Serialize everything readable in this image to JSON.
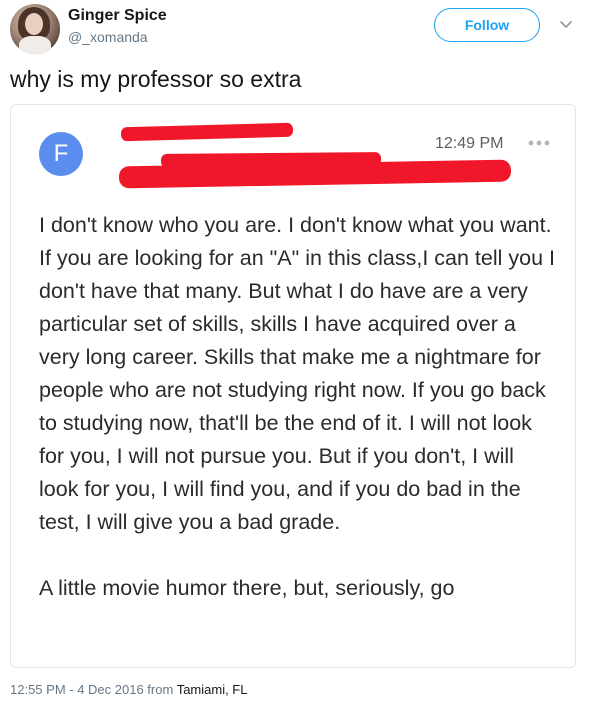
{
  "author": {
    "display_name": "Ginger Spice",
    "handle": "@_xomanda"
  },
  "actions": {
    "follow_label": "Follow",
    "menu_icon": "chevron-down-icon"
  },
  "tweet": {
    "text": "why is my professor so extra"
  },
  "email": {
    "sender_initial": "F",
    "time": "12:49 PM",
    "more_icon": "more-dots-icon",
    "paragraphs": [
      "I don't know who you are. I don't know what you want. If you are looking for an \"A\" in this class,I can tell you I don't have that many. But what I do have are a very particular set of skills, skills I have acquired over a very long career. Skills that make me a nightmare for people who are not studying right now. If you go back to studying now, that'll be the end of it.  I will not look for you, I will not pursue you. But if you don't, I will look for you, I will find you, and if you do bad in the test, I will give you a bad grade.",
      "A little movie humor there, but, seriously, go"
    ]
  },
  "footer": {
    "timestamp": "12:55 PM - 4 Dec 2016 from ",
    "place": "Tamiami, FL"
  },
  "colors": {
    "accent": "#1da1f2",
    "redaction": "#f1172b",
    "email_avatar": "#5b8def"
  }
}
